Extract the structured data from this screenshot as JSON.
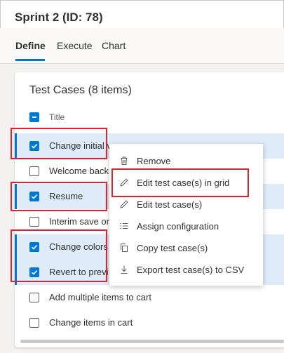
{
  "page": {
    "title": "Sprint 2 (ID: 78)"
  },
  "tabs": [
    {
      "label": "Define",
      "active": true
    },
    {
      "label": "Execute",
      "active": false
    },
    {
      "label": "Chart",
      "active": false
    }
  ],
  "card": {
    "title": "Test Cases (8 items)",
    "column_title": "Title"
  },
  "rows": [
    {
      "label": "Change initial v",
      "checked": true
    },
    {
      "label": "Welcome back",
      "checked": false
    },
    {
      "label": "Resume",
      "checked": true
    },
    {
      "label": "Interim save or",
      "checked": false
    },
    {
      "label": "Change colors",
      "checked": true
    },
    {
      "label": "Revert to previ",
      "checked": true
    },
    {
      "label": "Add multiple items to cart",
      "checked": false
    },
    {
      "label": "Change items in cart",
      "checked": false
    }
  ],
  "context_menu": {
    "items": [
      {
        "label": "Remove",
        "icon": "trash-icon"
      },
      {
        "label": "Edit test case(s) in grid",
        "icon": "pencil-icon"
      },
      {
        "label": "Edit test case(s)",
        "icon": "pencil-icon"
      },
      {
        "label": "Assign configuration",
        "icon": "list-icon"
      },
      {
        "label": "Copy test case(s)",
        "icon": "copy-icon"
      },
      {
        "label": "Export test case(s) to CSV",
        "icon": "download-icon"
      }
    ]
  },
  "colors": {
    "accent": "#0078d4",
    "selected_row": "#deecf9",
    "highlight": "#e0202a"
  }
}
